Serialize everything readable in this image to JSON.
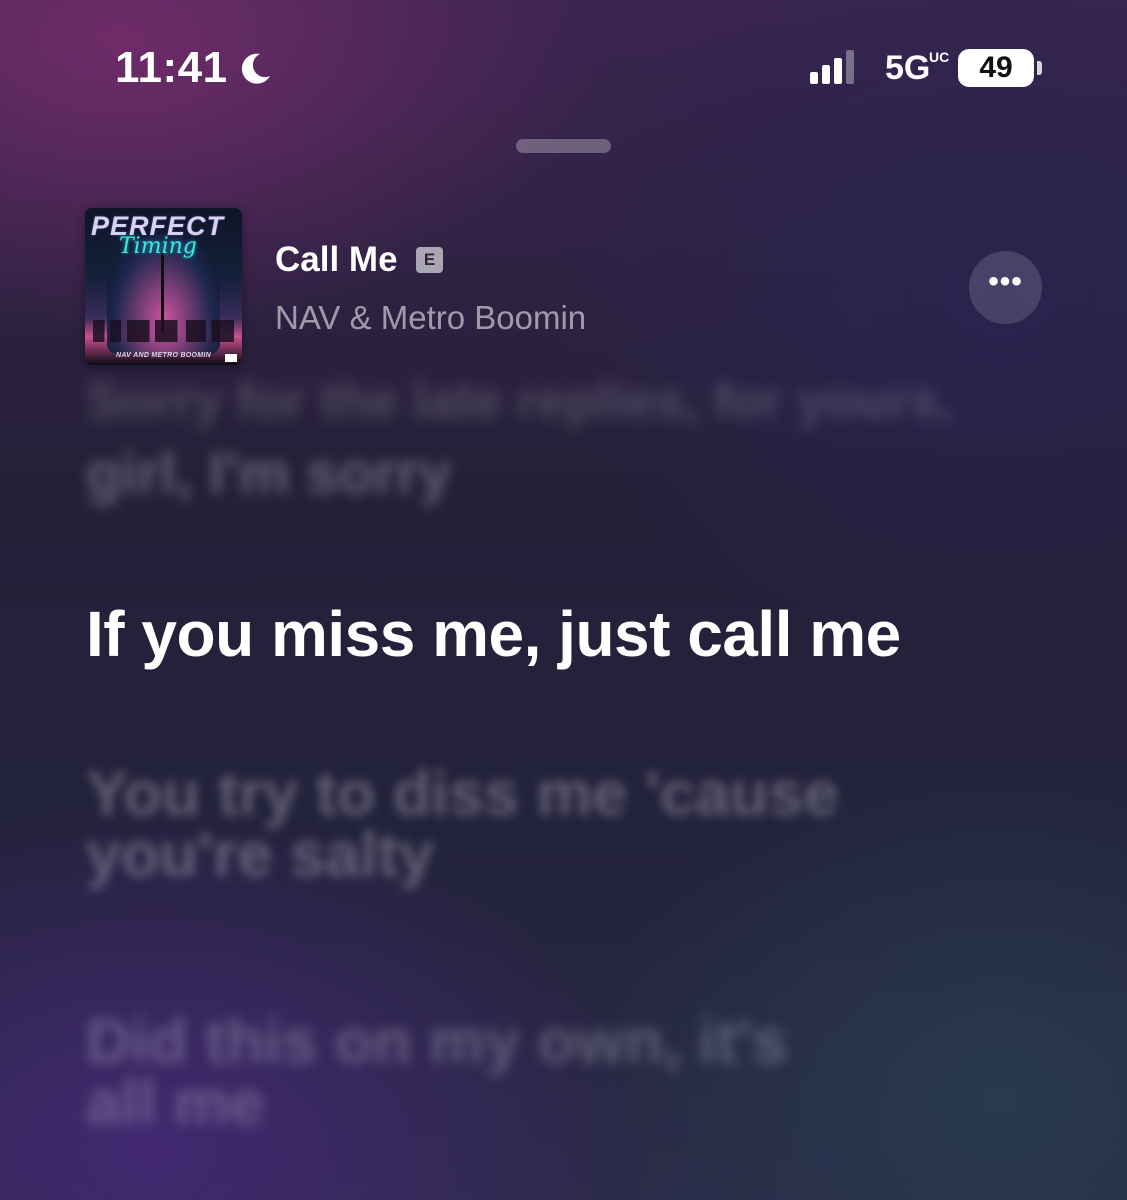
{
  "status_bar": {
    "time": "11:41",
    "moon_icon": "moon-icon",
    "signal_icon": "cellular-signal-icon",
    "network": "5G",
    "network_suffix": "UC",
    "battery": "49"
  },
  "now_playing": {
    "album_art": {
      "title_top": "PERFECT",
      "title_script": "Timing",
      "credit": "NAV AND METRO BOOMIN"
    },
    "song_title": "Call Me",
    "explicit": "E",
    "artist": "NAV & Metro Boomin",
    "more_icon": "ellipsis-icon",
    "more_label": "•••"
  },
  "lyrics": {
    "past_partial": "Sorry for the late replies, for yours,",
    "past": "girl, I'm sorry",
    "current": "If you miss me, just call me",
    "next": "You try to diss me 'cause you're salty",
    "next2": "Did this on my own, it's all me"
  },
  "colors": {
    "background_top": "#3a2450",
    "background_bottom": "#2b2a48",
    "current_lyric": "#ffffff",
    "secondary_text": "#9c93ad"
  }
}
